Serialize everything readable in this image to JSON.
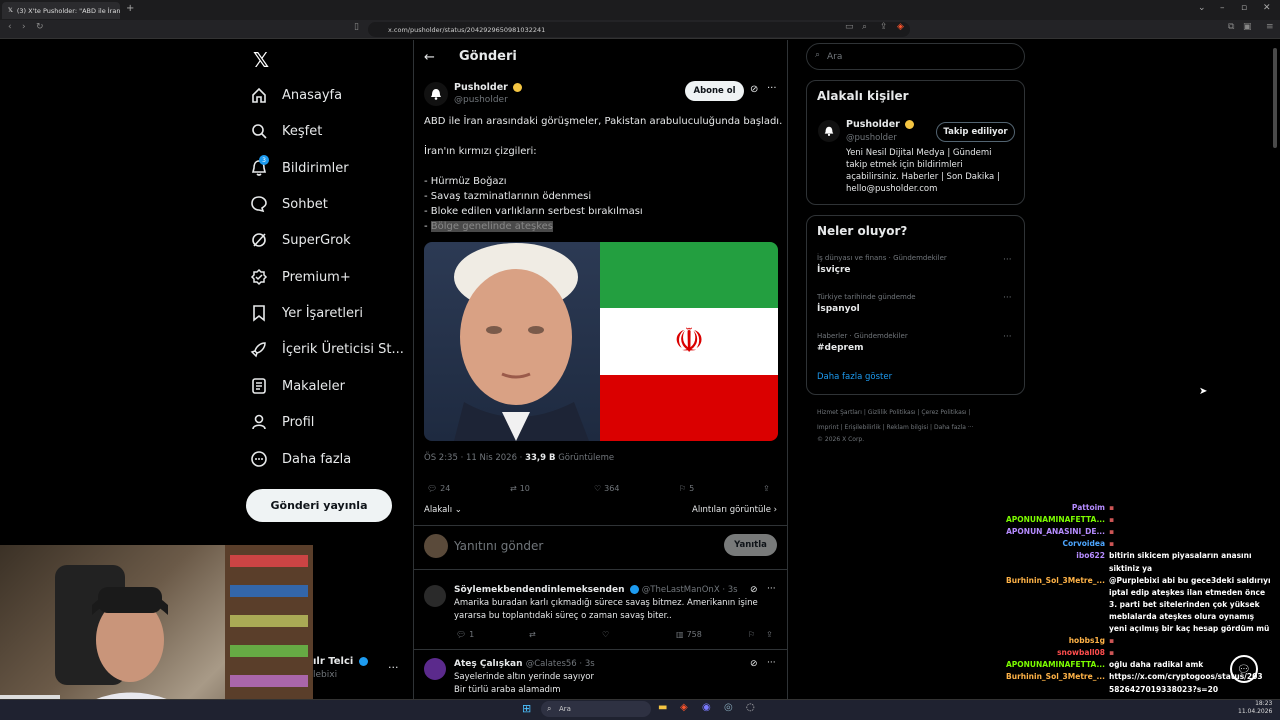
{
  "browser": {
    "tab_title": "(3) X'te Pusholder: \"ABD ile İran ...",
    "url": "x.com/pusholder/status/2042929650981032241"
  },
  "nav": {
    "items": [
      {
        "label": "Anasayfa",
        "icon": "home-icon"
      },
      {
        "label": "Keşfet",
        "icon": "search-icon"
      },
      {
        "label": "Bildirimler",
        "icon": "bell-icon",
        "badge": "3"
      },
      {
        "label": "Sohbet",
        "icon": "chat-icon"
      },
      {
        "label": "SuperGrok",
        "icon": "grok-icon"
      },
      {
        "label": "Premium+",
        "icon": "premium-icon"
      },
      {
        "label": "Yer İşaretleri",
        "icon": "bookmark-icon"
      },
      {
        "label": "İçerik Üreticisi St...",
        "icon": "rocket-icon"
      },
      {
        "label": "Makaleler",
        "icon": "article-icon"
      },
      {
        "label": "Profil",
        "icon": "user-icon"
      },
      {
        "label": "Daha fazla",
        "icon": "more-icon"
      }
    ],
    "post_button": "Gönderi yayınla",
    "account_name": "ılr Telci",
    "account_handle": "lebixi"
  },
  "main": {
    "header_title": "Gönderi",
    "author": {
      "name": "Pusholder",
      "handle": "@pusholder"
    },
    "subscribe_label": "Abone ol",
    "text_lines": [
      "ABD ile İran arasındaki görüşmeler, Pakistan arabuluculuğunda başladı.",
      "İran'ın kırmızı çizgileri:",
      "- Hürmüz Boğazı",
      "- Savaş tazminatlarının ödenmesi",
      "- Bloke edilen varlıkların serbest bırakılması"
    ],
    "text_last_prefix": "- ",
    "text_last_highlight": "Bölge genelinde ateşkes",
    "time": "ÖS 2:35 · 11 Nis 2026 · ",
    "views": "33,9 B",
    "views_label": " Görüntüleme",
    "stats": {
      "replies": "24",
      "reposts": "10",
      "likes": "364",
      "bookmarks": "5"
    },
    "relevant_label": "Alakalı",
    "quotes_label": "Alıntıları görüntüle",
    "reply_placeholder": "Yanıtını gönder",
    "reply_button": "Yanıtla",
    "replies": [
      {
        "name": "Söylemekbendendinlemeksenden",
        "handle": "@TheLastManOnX · 3s",
        "lines": [
          "Amarika buradan karlı çıkmadığı sürece savaş bitmez. Amerikanın işine",
          "yararsa bu toplantıdaki süreç o zaman savaş biter.."
        ],
        "replies": "1",
        "likes": "",
        "views": "758"
      },
      {
        "name": "Ateş Çalışkan",
        "handle": "@Calates56 · 3s",
        "lines": [
          "Sayelerinde altın yerinde sayıyor",
          "Bir türlü araba alamadım"
        ]
      }
    ]
  },
  "right": {
    "search_placeholder": "Ara",
    "related_title": "Alakalı kişiler",
    "related_name": "Pusholder",
    "related_handle": "@pusholder",
    "following_label": "Takip ediliyor",
    "bio_lines": [
      "Yeni Nesil Dijital Medya | Gündemi",
      "takip etmek için bildirimleri",
      "açabilirsiniz. Haberler | Son Dakika |",
      "hello@pusholder.com"
    ],
    "trends_title": "Neler oluyor?",
    "trends": [
      {
        "category": "İş dünyası ve finans · Gündemdekiler",
        "topic": "İsviçre"
      },
      {
        "category": "Türkiye tarihinde gündemde",
        "topic": "İspanyol"
      },
      {
        "category": "Haberler · Gündemdekiler",
        "topic": "#deprem"
      }
    ],
    "show_more": "Daha fazla göster",
    "footer_line1": "Hizmet Şartları  |  Gizlilik Politikası  |  Çerez Politikası  |",
    "footer_line2": "Imprint  |  Erişilebilirlik  |  Reklam bilgisi  |  Daha fazla ···",
    "footer_line3": "© 2026 X Corp."
  },
  "chat": [
    {
      "user": "Pattoim",
      "color": "#b68cff",
      "msg": ""
    },
    {
      "user": "APONUNAMINAFETTA...",
      "color": "#7cfc00",
      "msg": ""
    },
    {
      "user": "APONUN_ANASINI_DE...",
      "color": "#b68cff",
      "msg": ""
    },
    {
      "user": "Corvoidea",
      "color": "#4da6ff",
      "msg": ""
    },
    {
      "user": "ibo622",
      "color": "#b68cff",
      "msg": "bitirin sikicem piyasaların anasını"
    },
    {
      "user": "",
      "color": "#ffffff",
      "msg": "siktiniz ya"
    },
    {
      "user": "Burhinin_Sol_3Metre_...",
      "color": "#ffb347",
      "msg": "@Purplebixi abi bu gece3deki saldırıyı"
    },
    {
      "user": "",
      "color": "#ffffff",
      "msg": "iptal edip ateşkes ilan etmeden önce"
    },
    {
      "user": "",
      "color": "#ffffff",
      "msg": "3. parti bet sitelerinden çok yüksek"
    },
    {
      "user": "",
      "color": "#ffffff",
      "msg": "meblalarda ateşkes olura oynamış"
    },
    {
      "user": "",
      "color": "#ffffff",
      "msg": "yeni açılmış bir kaç hesap gördüm mü"
    },
    {
      "user": "hobbs1g",
      "color": "#ffb347",
      "msg": ""
    },
    {
      "user": "snowball08",
      "color": "#ff4d4d",
      "msg": ""
    },
    {
      "user": "APONUNAMINAFETTA...",
      "color": "#7cfc00",
      "msg": "oğlu daha radikal amk"
    },
    {
      "user": "Burhinin_Sol_3Metre_...",
      "color": "#ffb347",
      "msg": "https://x.com/cryptogoos/status/203"
    },
    {
      "user": "",
      "color": "#ffffff",
      "msg": "5826427019338023?s=20"
    }
  ],
  "taskbar": {
    "search": "Ara",
    "time": "18:23",
    "date": "11.04.2026"
  },
  "colors": {
    "accent": "#1d9bf0",
    "verified_gold": "#f4c542",
    "background": "#000000"
  }
}
